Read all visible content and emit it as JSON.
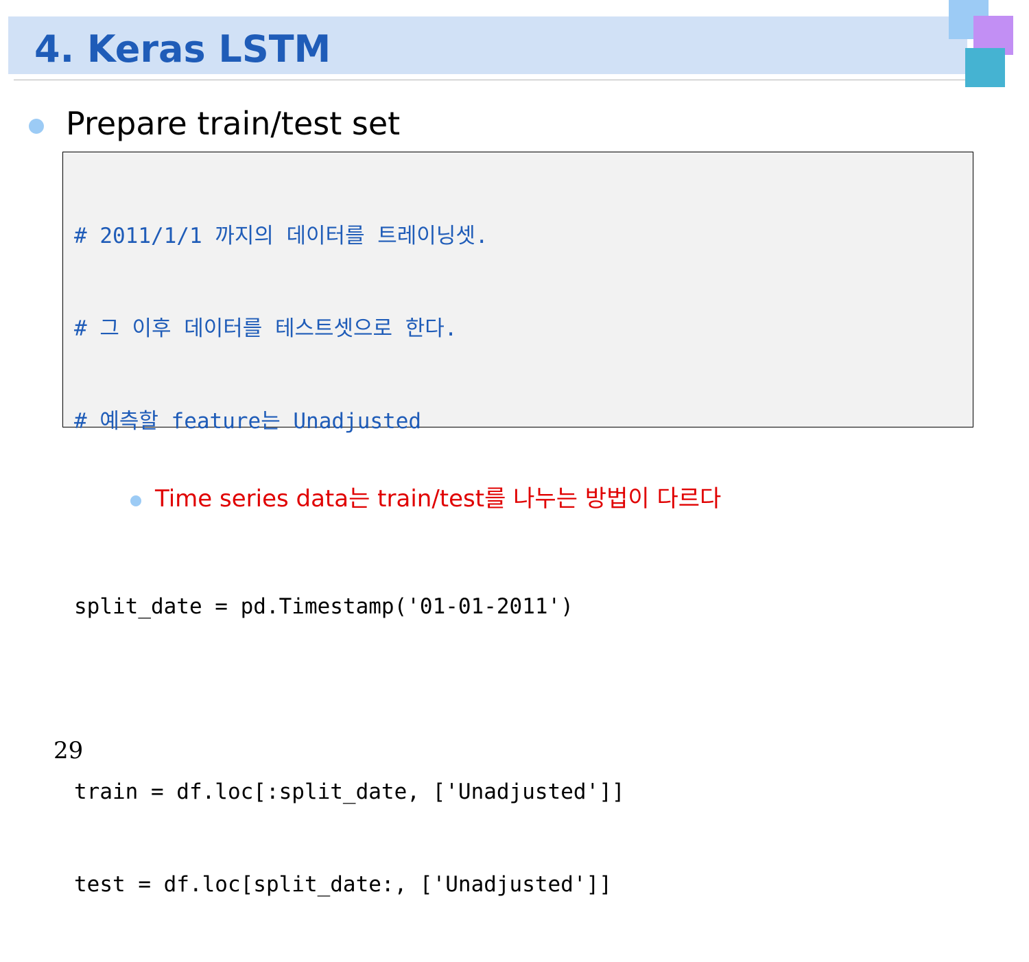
{
  "slide": {
    "title": "4. Keras LSTM",
    "heading": "Prepare train/test set",
    "code_lines": [
      {
        "text": "# 2011/1/1 까지의 데이터를 트레이닝셋.",
        "kind": "comment"
      },
      {
        "text": "# 그 이후 데이터를 테스트셋으로 한다.",
        "kind": "comment"
      },
      {
        "text": "# 예측할 feature는 Unadjusted",
        "kind": "comment"
      },
      {
        "text": "",
        "kind": "blank"
      },
      {
        "text": "split_date = pd.Timestamp('01-01-2011')",
        "kind": "code"
      },
      {
        "text": "",
        "kind": "blank"
      },
      {
        "text": "train = df.loc[:split_date, ['Unadjusted']]",
        "kind": "code"
      },
      {
        "text": "test = df.loc[split_date:, ['Unadjusted']]",
        "kind": "code"
      }
    ],
    "note": "Time series data는 train/test를 나누는 방법이 다르다",
    "page_number": "29"
  },
  "colors": {
    "title_band": "#d1e1f6",
    "title_text": "#1f5cb8",
    "comment_text": "#1f5cb8",
    "bullet": "#9ccbf5",
    "note_text": "#e00000",
    "code_background": "#f2f2f2",
    "deco_light_blue": "#9ccbf5",
    "deco_purple": "#c28ff4",
    "deco_teal": "#45b3d2"
  }
}
